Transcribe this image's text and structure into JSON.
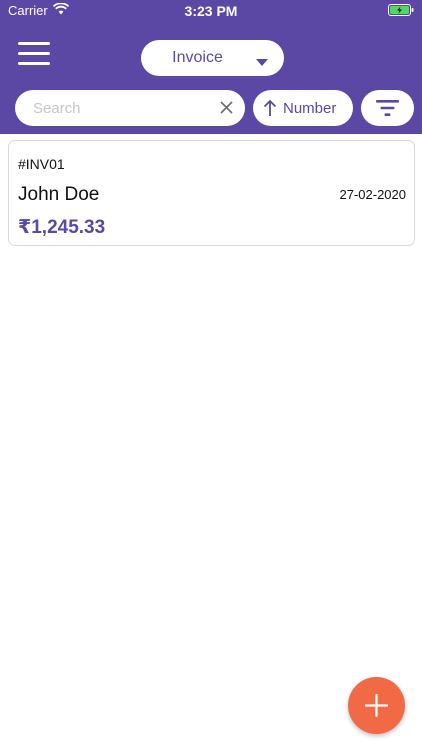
{
  "status_bar": {
    "carrier": "Carrier",
    "time": "3:23 PM"
  },
  "header": {
    "background_color": "#5a48a4",
    "document_type": "Invoice",
    "search": {
      "placeholder": "Search",
      "value": ""
    },
    "sort": {
      "label": "Number",
      "direction_icon": "arrow-up-icon"
    },
    "filter_icon": "filter-icon",
    "menu_icon": "hamburger-menu-icon"
  },
  "invoices": [
    {
      "number": "#INV01",
      "customer": "John Doe",
      "date": "27-02-2020",
      "amount": "₹1,245.33"
    }
  ],
  "fab": {
    "icon": "plus-icon",
    "color": "#f26a45"
  },
  "colors": {
    "accent": "#5a48a4",
    "fab": "#f26a45",
    "card_border": "#d9d9dd"
  }
}
